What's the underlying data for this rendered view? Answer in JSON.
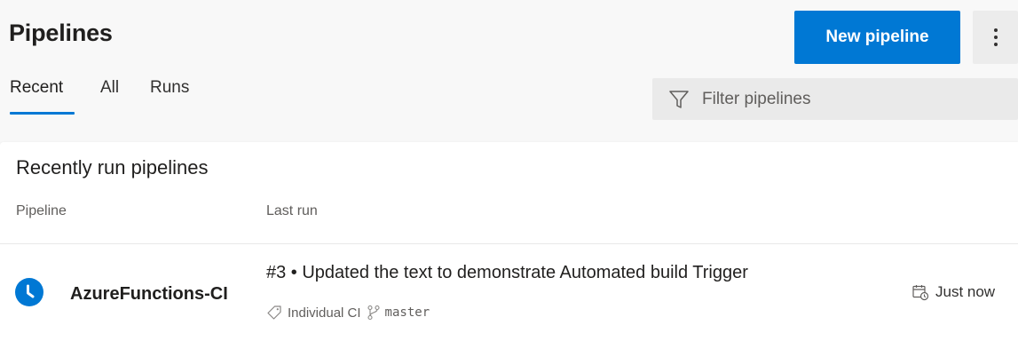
{
  "header": {
    "title": "Pipelines",
    "new_button_label": "New pipeline",
    "more_icon": "more-vertical-icon"
  },
  "tabs": [
    {
      "label": "Recent",
      "selected": true
    },
    {
      "label": "All",
      "selected": false
    },
    {
      "label": "Runs",
      "selected": false
    }
  ],
  "filter": {
    "placeholder": "Filter pipelines",
    "icon": "filter-icon"
  },
  "recent_runs": {
    "title": "Recently run pipelines",
    "columns": [
      "Pipeline",
      "Last run"
    ],
    "rows": [
      {
        "status_icon": "clock-icon",
        "status_color": "#0078d4",
        "pipeline": "AzureFunctions-CI",
        "last_run": {
          "title": "#3 • Updated the text to demonstrate Automated build Trigger",
          "reason": "Individual CI",
          "branch": "master",
          "time": "Just now"
        }
      }
    ]
  },
  "colors": {
    "accent": "#0078d4",
    "background": "#f8f8f8",
    "card": "#ffffff"
  }
}
